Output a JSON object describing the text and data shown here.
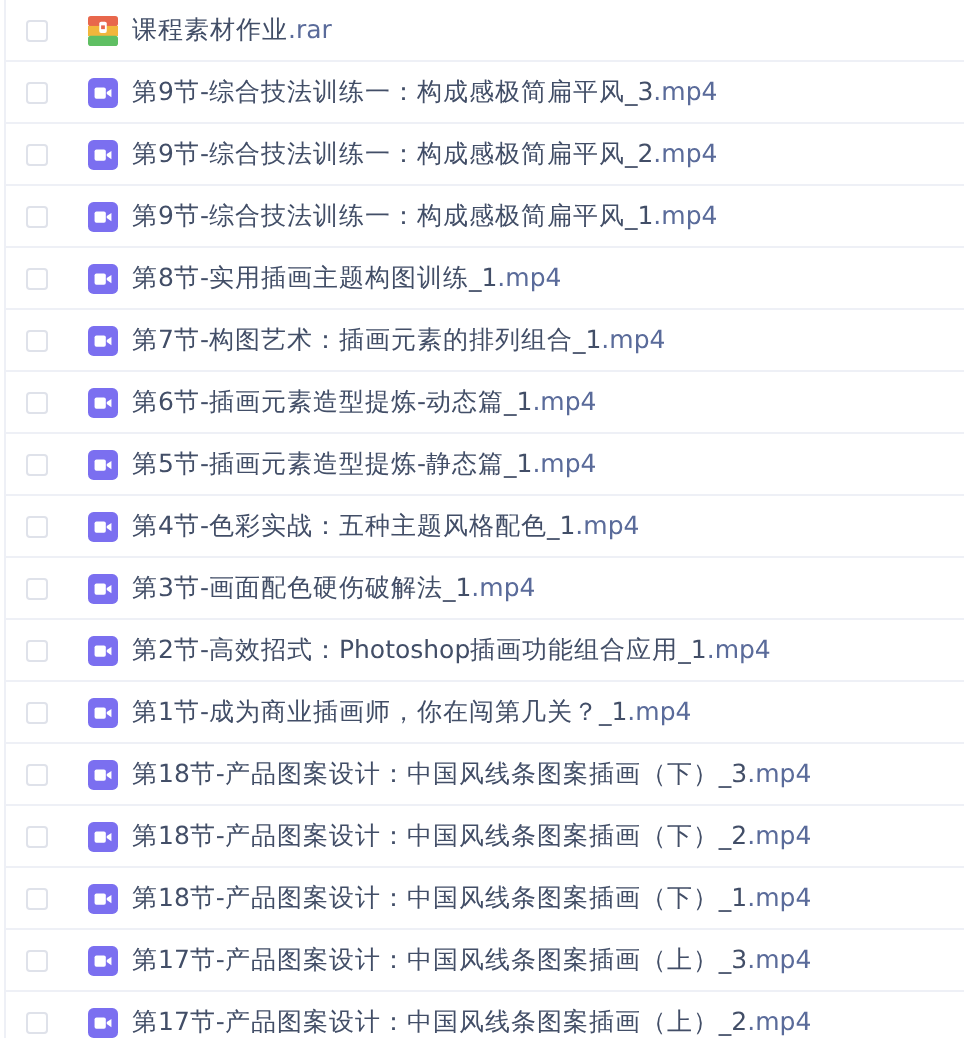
{
  "files": [
    {
      "kind": "archive",
      "name": "课程素材作业",
      "extension": ".rar",
      "checked": false
    },
    {
      "kind": "video",
      "name": "第9节-综合技法训练一：构成感极简扁平风_3",
      "extension": ".mp4",
      "checked": false
    },
    {
      "kind": "video",
      "name": "第9节-综合技法训练一：构成感极简扁平风_2",
      "extension": ".mp4",
      "checked": false
    },
    {
      "kind": "video",
      "name": "第9节-综合技法训练一：构成感极简扁平风_1",
      "extension": ".mp4",
      "checked": false
    },
    {
      "kind": "video",
      "name": "第8节-实用插画主题构图训练_1",
      "extension": ".mp4",
      "checked": false
    },
    {
      "kind": "video",
      "name": "第7节-构图艺术：插画元素的排列组合_1",
      "extension": ".mp4",
      "checked": false
    },
    {
      "kind": "video",
      "name": "第6节-插画元素造型提炼-动态篇_1",
      "extension": ".mp4",
      "checked": false
    },
    {
      "kind": "video",
      "name": "第5节-插画元素造型提炼-静态篇_1",
      "extension": ".mp4",
      "checked": false
    },
    {
      "kind": "video",
      "name": "第4节-色彩实战：五种主题风格配色_1",
      "extension": ".mp4",
      "checked": false
    },
    {
      "kind": "video",
      "name": "第3节-画面配色硬伤破解法_1",
      "extension": ".mp4",
      "checked": false
    },
    {
      "kind": "video",
      "name": "第2节-高效招式：Photoshop插画功能组合应用_1",
      "extension": ".mp4",
      "checked": false
    },
    {
      "kind": "video",
      "name": "第1节-成为商业插画师，你在闯第几关？_1",
      "extension": ".mp4",
      "checked": false
    },
    {
      "kind": "video",
      "name": "第18节-产品图案设计：中国风线条图案插画（下）_3",
      "extension": ".mp4",
      "checked": false
    },
    {
      "kind": "video",
      "name": "第18节-产品图案设计：中国风线条图案插画（下）_2",
      "extension": ".mp4",
      "checked": false
    },
    {
      "kind": "video",
      "name": "第18节-产品图案设计：中国风线条图案插画（下）_1",
      "extension": ".mp4",
      "checked": false
    },
    {
      "kind": "video",
      "name": "第17节-产品图案设计：中国风线条图案插画（上）_3",
      "extension": ".mp4",
      "checked": false
    },
    {
      "kind": "video",
      "name": "第17节-产品图案设计：中国风线条图案插画（上）_2",
      "extension": ".mp4",
      "checked": false
    }
  ]
}
